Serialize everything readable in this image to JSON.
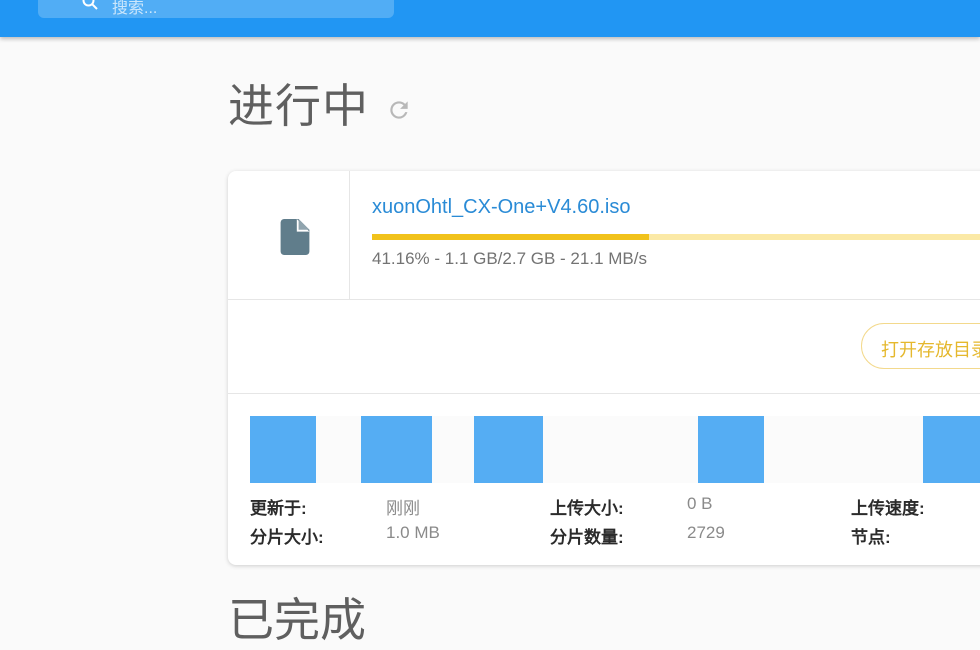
{
  "header": {
    "search_placeholder": "搜索..."
  },
  "in_progress": {
    "title": "进行中"
  },
  "task": {
    "file_icon": "file-icon",
    "file_name": "xuonOhtl_CX-One+V4.60.iso",
    "progress_percent": 41.16,
    "progress_text": "41.16% - 1.1 GB/2.7 GB - 21.1 MB/s",
    "open_folder_label": "打开存放目录",
    "info": {
      "updated_label": "更新于:",
      "updated_value": "刚刚",
      "upload_size_label": "上传大小:",
      "upload_size_value": "0 B",
      "upload_speed_label": "上传速度:",
      "piece_size_label": "分片大小:",
      "piece_size_value": "1.0 MB",
      "piece_count_label": "分片数量:",
      "piece_count_value": "2729",
      "nodes_label": "节点:"
    }
  },
  "completed": {
    "title": "已完成"
  },
  "colors": {
    "appbar": "#2196f3",
    "accent_link": "#2a8bd6",
    "progress_fill": "#f1c21b",
    "progress_track": "#fbe9a6",
    "piece": "#55adf3",
    "file_icon": "#607d8b"
  }
}
